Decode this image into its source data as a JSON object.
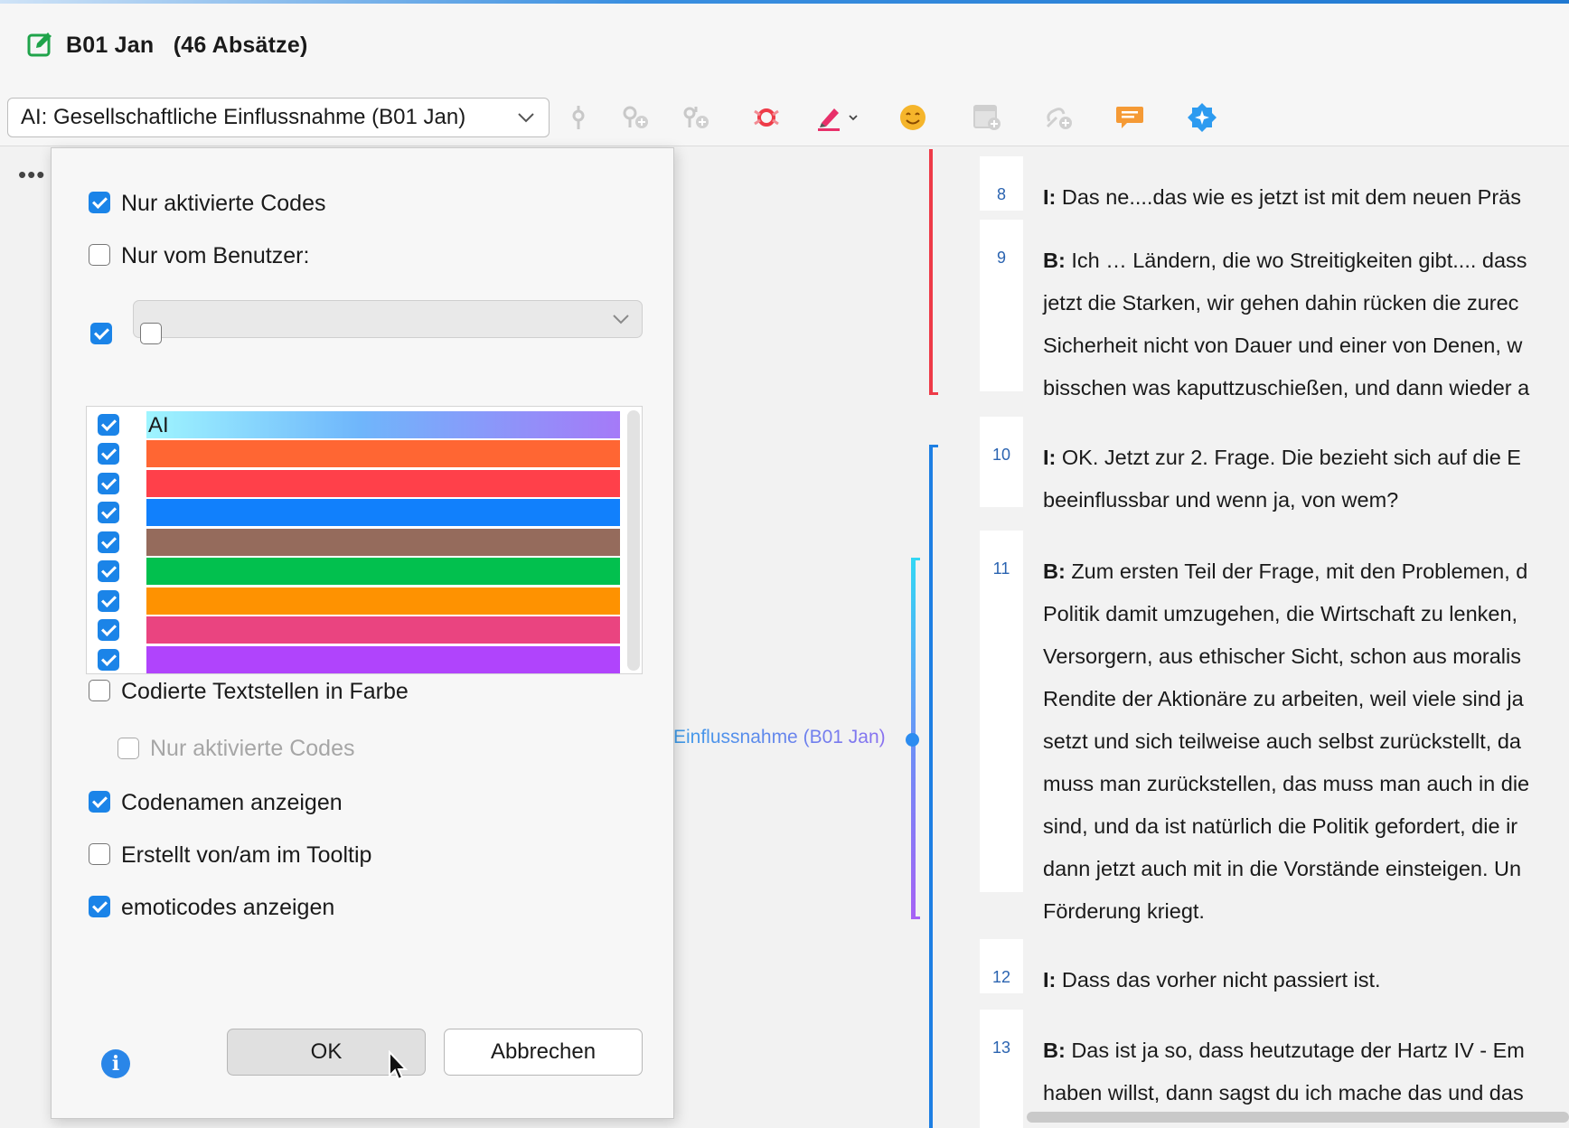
{
  "window": {
    "title": "B01 Jan",
    "subtitle": "(46 Absätze)"
  },
  "toolbar": {
    "document_selector": "AI: Gesellschaftliche Einflussnahme (B01 Jan)",
    "icons": [
      "pin-icon",
      "code-add-icon",
      "code-multi-add-icon",
      "code-highlight-icon",
      "marker-pen-icon",
      "emoticode-icon",
      "memo-icon",
      "link-code-icon",
      "comment-icon",
      "ai-assist-icon"
    ],
    "accent_colors": {
      "red": "#ee3b48",
      "pen": "#e8306a",
      "smiley": "#f5b52b",
      "comment": "#f59a35",
      "ai": "#2d9bf0"
    }
  },
  "dialog": {
    "only_activated_codes": {
      "label": "Nur aktivierte Codes",
      "checked": true
    },
    "only_by_user": {
      "label": "Nur vom Benutzer:",
      "checked": false,
      "selected_user": ""
    },
    "select_all": {
      "checked": true
    },
    "select_none": {
      "checked": false
    },
    "colors": [
      {
        "label": "AI",
        "color": "gradient",
        "checked": true
      },
      {
        "label": "",
        "color": "#ff6633",
        "checked": true
      },
      {
        "label": "",
        "color": "#ff404a",
        "checked": true
      },
      {
        "label": "",
        "color": "#1180fc",
        "checked": true
      },
      {
        "label": "",
        "color": "#956b5c",
        "checked": true
      },
      {
        "label": "",
        "color": "#02c04e",
        "checked": true
      },
      {
        "label": "",
        "color": "#fe9201",
        "checked": true
      },
      {
        "label": "",
        "color": "#ea4480",
        "checked": true
      },
      {
        "label": "",
        "color": "#b044fc",
        "checked": true
      }
    ],
    "coded_segments_in_color": {
      "label": "Codierte Textstellen in Farbe",
      "checked": false
    },
    "nested_only_activated": {
      "label": "Nur aktivierte Codes",
      "checked": false,
      "disabled": true
    },
    "show_code_names": {
      "label": "Codenamen anzeigen",
      "checked": true
    },
    "created_tooltip": {
      "label": "Erstellt von/am im Tooltip",
      "checked": false
    },
    "show_emoticodes": {
      "label": "emoticodes anzeigen",
      "checked": true
    },
    "ok_label": "OK",
    "cancel_label": "Abbrechen"
  },
  "coding_stripes": {
    "code_label": "Einflussnahme (B01 Jan)"
  },
  "document": {
    "paragraphs": [
      {
        "num": "8",
        "speaker": "I:",
        "lines": [
          "Das ne....das wie es jetzt ist mit dem neuen Präs"
        ]
      },
      {
        "num": "9",
        "speaker": "B:",
        "lines": [
          "Ich … Ländern, die wo Streitigkeiten gibt.... dass",
          "jetzt die Starken, wir gehen dahin rücken die zurec",
          "Sicherheit nicht von Dauer und einer von Denen, w",
          "bisschen was kaputtzuschießen, und dann wieder a"
        ]
      },
      {
        "num": "10",
        "speaker": "I:",
        "lines": [
          "OK. Jetzt zur 2. Frage. Die bezieht sich auf die E",
          "beeinflussbar und wenn ja, von wem?"
        ]
      },
      {
        "num": "11",
        "speaker": "B:",
        "lines": [
          "Zum ersten Teil der Frage, mit den Problemen, d",
          "Politik damit umzugehen, die Wirtschaft zu lenken,",
          "Versorgern, aus ethischer Sicht, schon aus moralis",
          "Rendite der Aktionäre zu arbeiten, weil viele sind ja",
          "setzt und sich teilweise auch selbst zurückstellt, da",
          "muss man zurückstellen, das muss man auch in die",
          "sind, und da ist natürlich die Politik gefordert, die ir",
          "dann jetzt auch mit in die Vorstände einsteigen. Un",
          "Förderung kriegt."
        ]
      },
      {
        "num": "12",
        "speaker": "I:",
        "lines": [
          "Dass das vorher nicht passiert ist."
        ]
      },
      {
        "num": "13",
        "speaker": "B:",
        "lines": [
          "Das ist ja so, dass heutzutage der Hartz IV - Em",
          "haben willst, dann sagst du ich mache das und das"
        ]
      }
    ]
  }
}
